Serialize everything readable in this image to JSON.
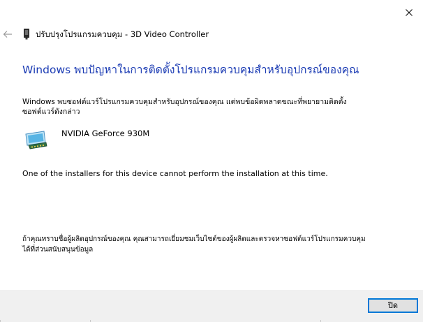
{
  "window": {
    "wizard_title": "ปรับปรุงโปรแกรมควบคุม - 3D Video Controller",
    "icons": {
      "close": "close-icon",
      "back": "back-arrow-icon",
      "device_small": "device-icon",
      "device_large": "display-adapter-icon"
    }
  },
  "main": {
    "heading": "Windows พบปัญหาในการติดตั้งโปรแกรมควบคุมสำหรับอุปกรณ์ของคุณ",
    "description": "Windows พบซอฟต์แวร์โปรแกรมควบคุมสำหรับอุปกรณ์ของคุณ แต่พบข้อผิดพลาดขณะที่พยายามติดตั้งซอฟต์แวร์ดังกล่าว",
    "device_name": "NVIDIA GeForce 930M",
    "error_message": "One of the installers for this device cannot perform the installation at this time.",
    "footer_note": "ถ้าคุณทราบชื่อผู้ผลิตอุปกรณ์ของคุณ คุณสามารถเยี่ยมชมเว็บไซต์ของผู้ผลิตและตรวจหาซอฟต์แวร์โปรแกรมควบคุมได้ที่ส่วนสนับสนุนข้อมูล"
  },
  "footer": {
    "close_label": "ปิด"
  },
  "colors": {
    "heading": "#1c3cb4",
    "footer_bg": "#f0f0f0",
    "button_border": "#0078d7",
    "button_bg": "#e1e1e1"
  }
}
